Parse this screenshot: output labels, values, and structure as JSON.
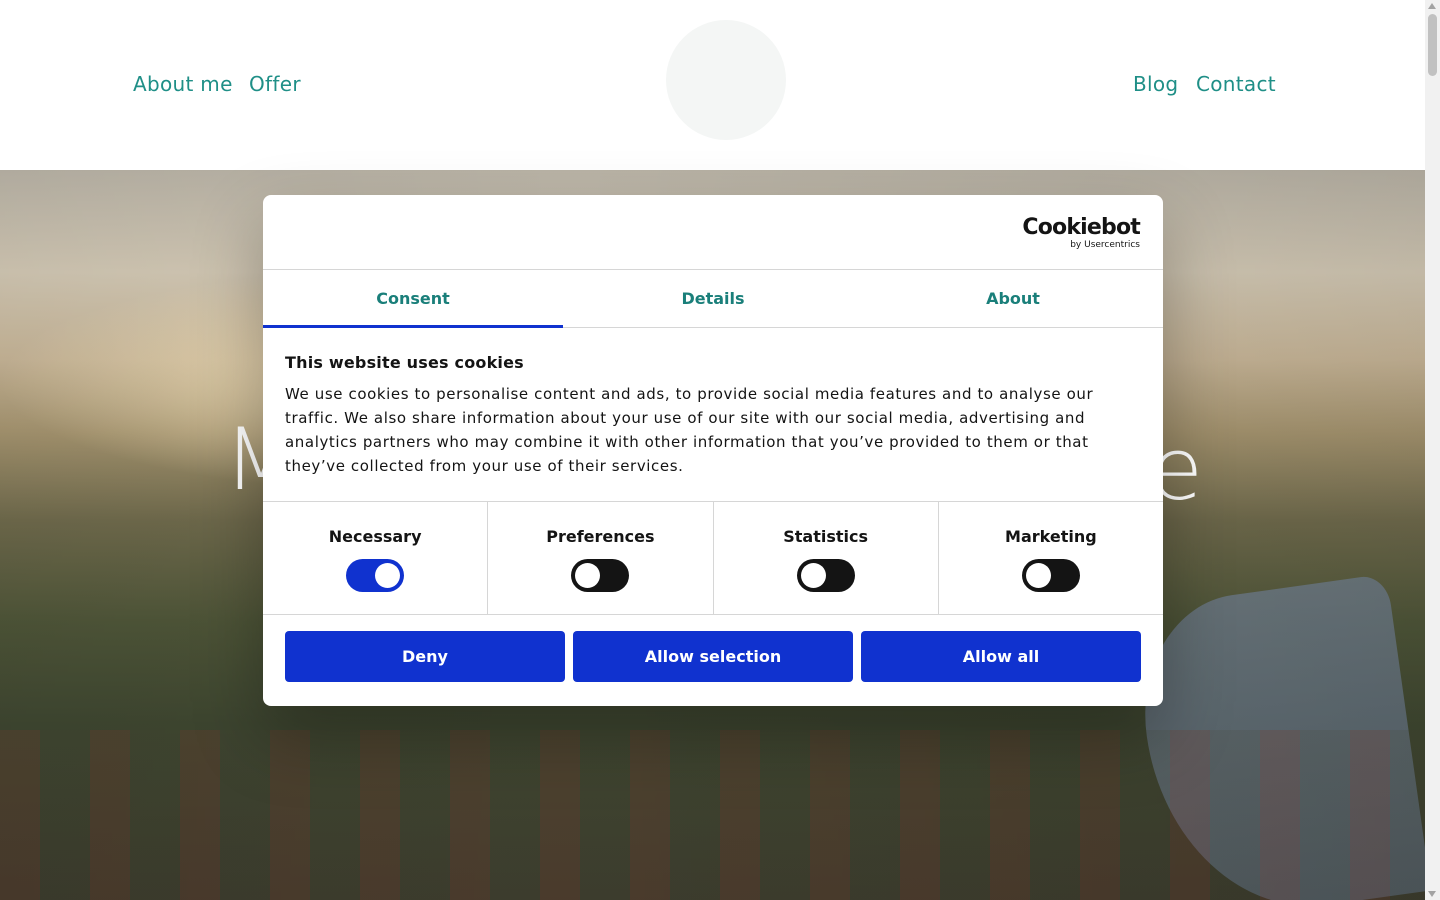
{
  "header": {
    "nav_left": [
      "About me",
      "Offer"
    ],
    "nav_right": [
      "Blog",
      "Contact"
    ]
  },
  "hero": {
    "title_start": "M",
    "title_end": "e"
  },
  "cookie_dialog": {
    "brand": "Cookiebot",
    "brand_sub": "by Usercentrics",
    "tabs": [
      "Consent",
      "Details",
      "About"
    ],
    "active_tab": "Consent",
    "title": "This website uses cookies",
    "text": "We use cookies to personalise content and ads, to provide social media features and to analyse our traffic. We also share information about your use of our site with our social media, advertising and analytics partners who may combine it with other information that you’ve provided to them or that they’ve collected from your use of their services.",
    "toggles": [
      {
        "label": "Necessary",
        "on": true
      },
      {
        "label": "Preferences",
        "on": false
      },
      {
        "label": "Statistics",
        "on": false
      },
      {
        "label": "Marketing",
        "on": false
      }
    ],
    "buttons": {
      "deny": "Deny",
      "allow_selection": "Allow selection",
      "allow_all": "Allow all"
    }
  },
  "colors": {
    "nav_link": "#1f8f87",
    "tab_text": "#1a7f7a",
    "primary_button": "#1032cf",
    "toggle_off": "#141414"
  }
}
